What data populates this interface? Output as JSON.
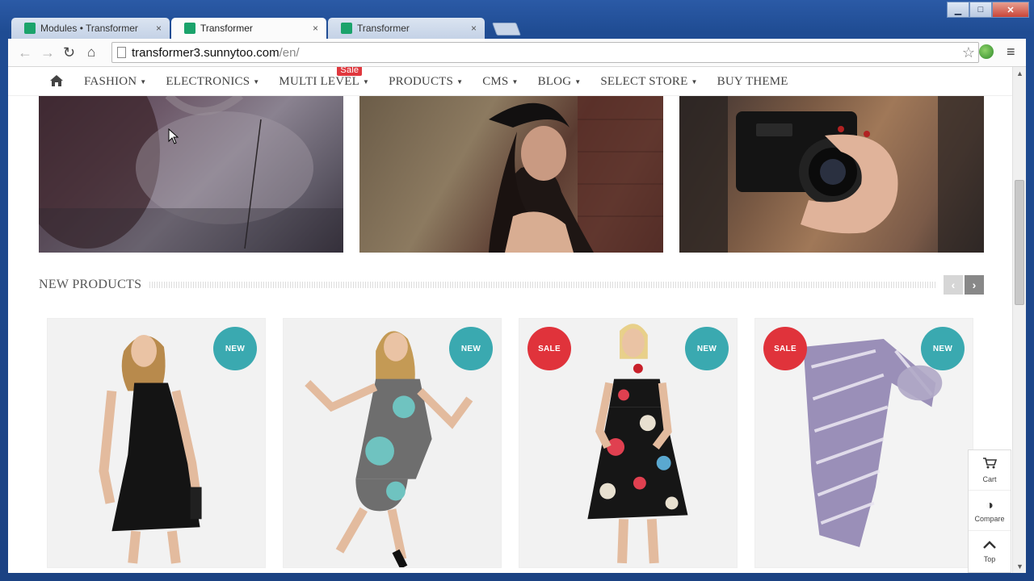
{
  "browser": {
    "tabs": [
      {
        "label": "Modules • Transformer",
        "state": "inactive"
      },
      {
        "label": "Transformer",
        "state": "active"
      },
      {
        "label": "Transformer",
        "state": "inactive"
      }
    ],
    "tab_close": "×",
    "url_host": "transformer3.sunnytoo.com",
    "url_path": "/en/",
    "icons": [
      "back-icon",
      "forward-icon",
      "reload-icon",
      "home-icon",
      "star-icon",
      "globe-icon",
      "menu-icon"
    ]
  },
  "window": {
    "minimize": "▁",
    "maximize": "□",
    "close": "✕"
  },
  "store_nav": {
    "items": [
      {
        "label": "FASHION",
        "caret": "▼"
      },
      {
        "label": "ELECTRONICS",
        "caret": "▼"
      },
      {
        "label": "MULTI LEVEL",
        "caret": "▼",
        "badge": "Sale"
      },
      {
        "label": "PRODUCTS",
        "caret": "▼"
      },
      {
        "label": "CMS",
        "caret": "▼"
      },
      {
        "label": "BLOG",
        "caret": "▼"
      },
      {
        "label": "SELECT STORE",
        "caret": "▼"
      },
      {
        "label": "BUY THEME",
        "caret": ""
      }
    ]
  },
  "section": {
    "title": "NEW PRODUCTS",
    "prev": "‹",
    "next": "›"
  },
  "products": [
    {
      "flags": [
        "NEW"
      ]
    },
    {
      "flags": [
        "NEW"
      ]
    },
    {
      "flags": [
        "SALE",
        "NEW"
      ]
    },
    {
      "flags": [
        "SALE",
        "NEW"
      ]
    }
  ],
  "flags": {
    "new": "NEW",
    "sale": "SALE"
  },
  "side_widget": {
    "cart": {
      "label": "Cart",
      "icon": "🛒"
    },
    "compare": {
      "label": "Compare",
      "icon": "◑"
    },
    "top": {
      "label": "Top",
      "icon": "︿"
    }
  },
  "colors": {
    "new_flag": "#3aa9b0",
    "sale_flag": "#e0333b",
    "sale_badge": "#e0383e"
  }
}
